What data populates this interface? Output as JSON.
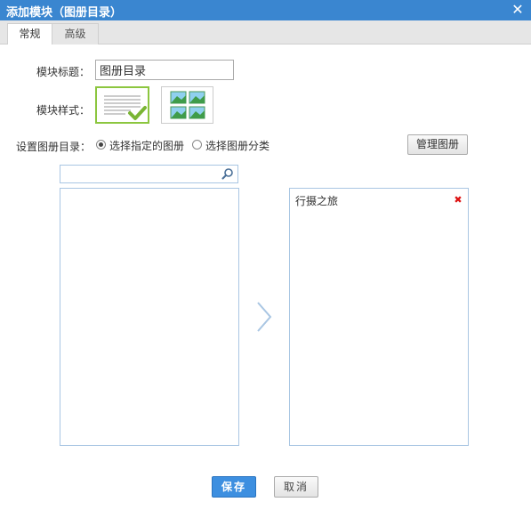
{
  "dialog": {
    "title": "添加模块（图册目录）",
    "close_label": "✕"
  },
  "tabs": [
    {
      "label": "常规",
      "active": true
    },
    {
      "label": "高级",
      "active": false
    }
  ],
  "form": {
    "title_label": "模块标题：",
    "title_value": "图册目录",
    "style_label": "模块样式：",
    "style_options": [
      {
        "icon": "list-style-icon",
        "selected": true
      },
      {
        "icon": "grid-style-icon",
        "selected": false
      }
    ],
    "catalog_label": "设置图册目录：",
    "radios": [
      {
        "label": "选择指定的图册",
        "checked": true
      },
      {
        "label": "选择图册分类",
        "checked": false
      }
    ],
    "manage_button": "管理图册"
  },
  "search": {
    "placeholder": "",
    "icon": "search-icon"
  },
  "available_list": [],
  "selected_list": [
    {
      "label": "行摄之旅"
    }
  ],
  "transfer_icon": "chevron-right-icon",
  "footer": {
    "save_label": "保存",
    "cancel_label": "取消"
  },
  "colors": {
    "title_bar": "#3a86d0",
    "selected_style_border": "#8cc63f",
    "panel_border": "#a9c6e3",
    "save_button": "#3d8fe0",
    "remove_icon": "#dd1111"
  }
}
